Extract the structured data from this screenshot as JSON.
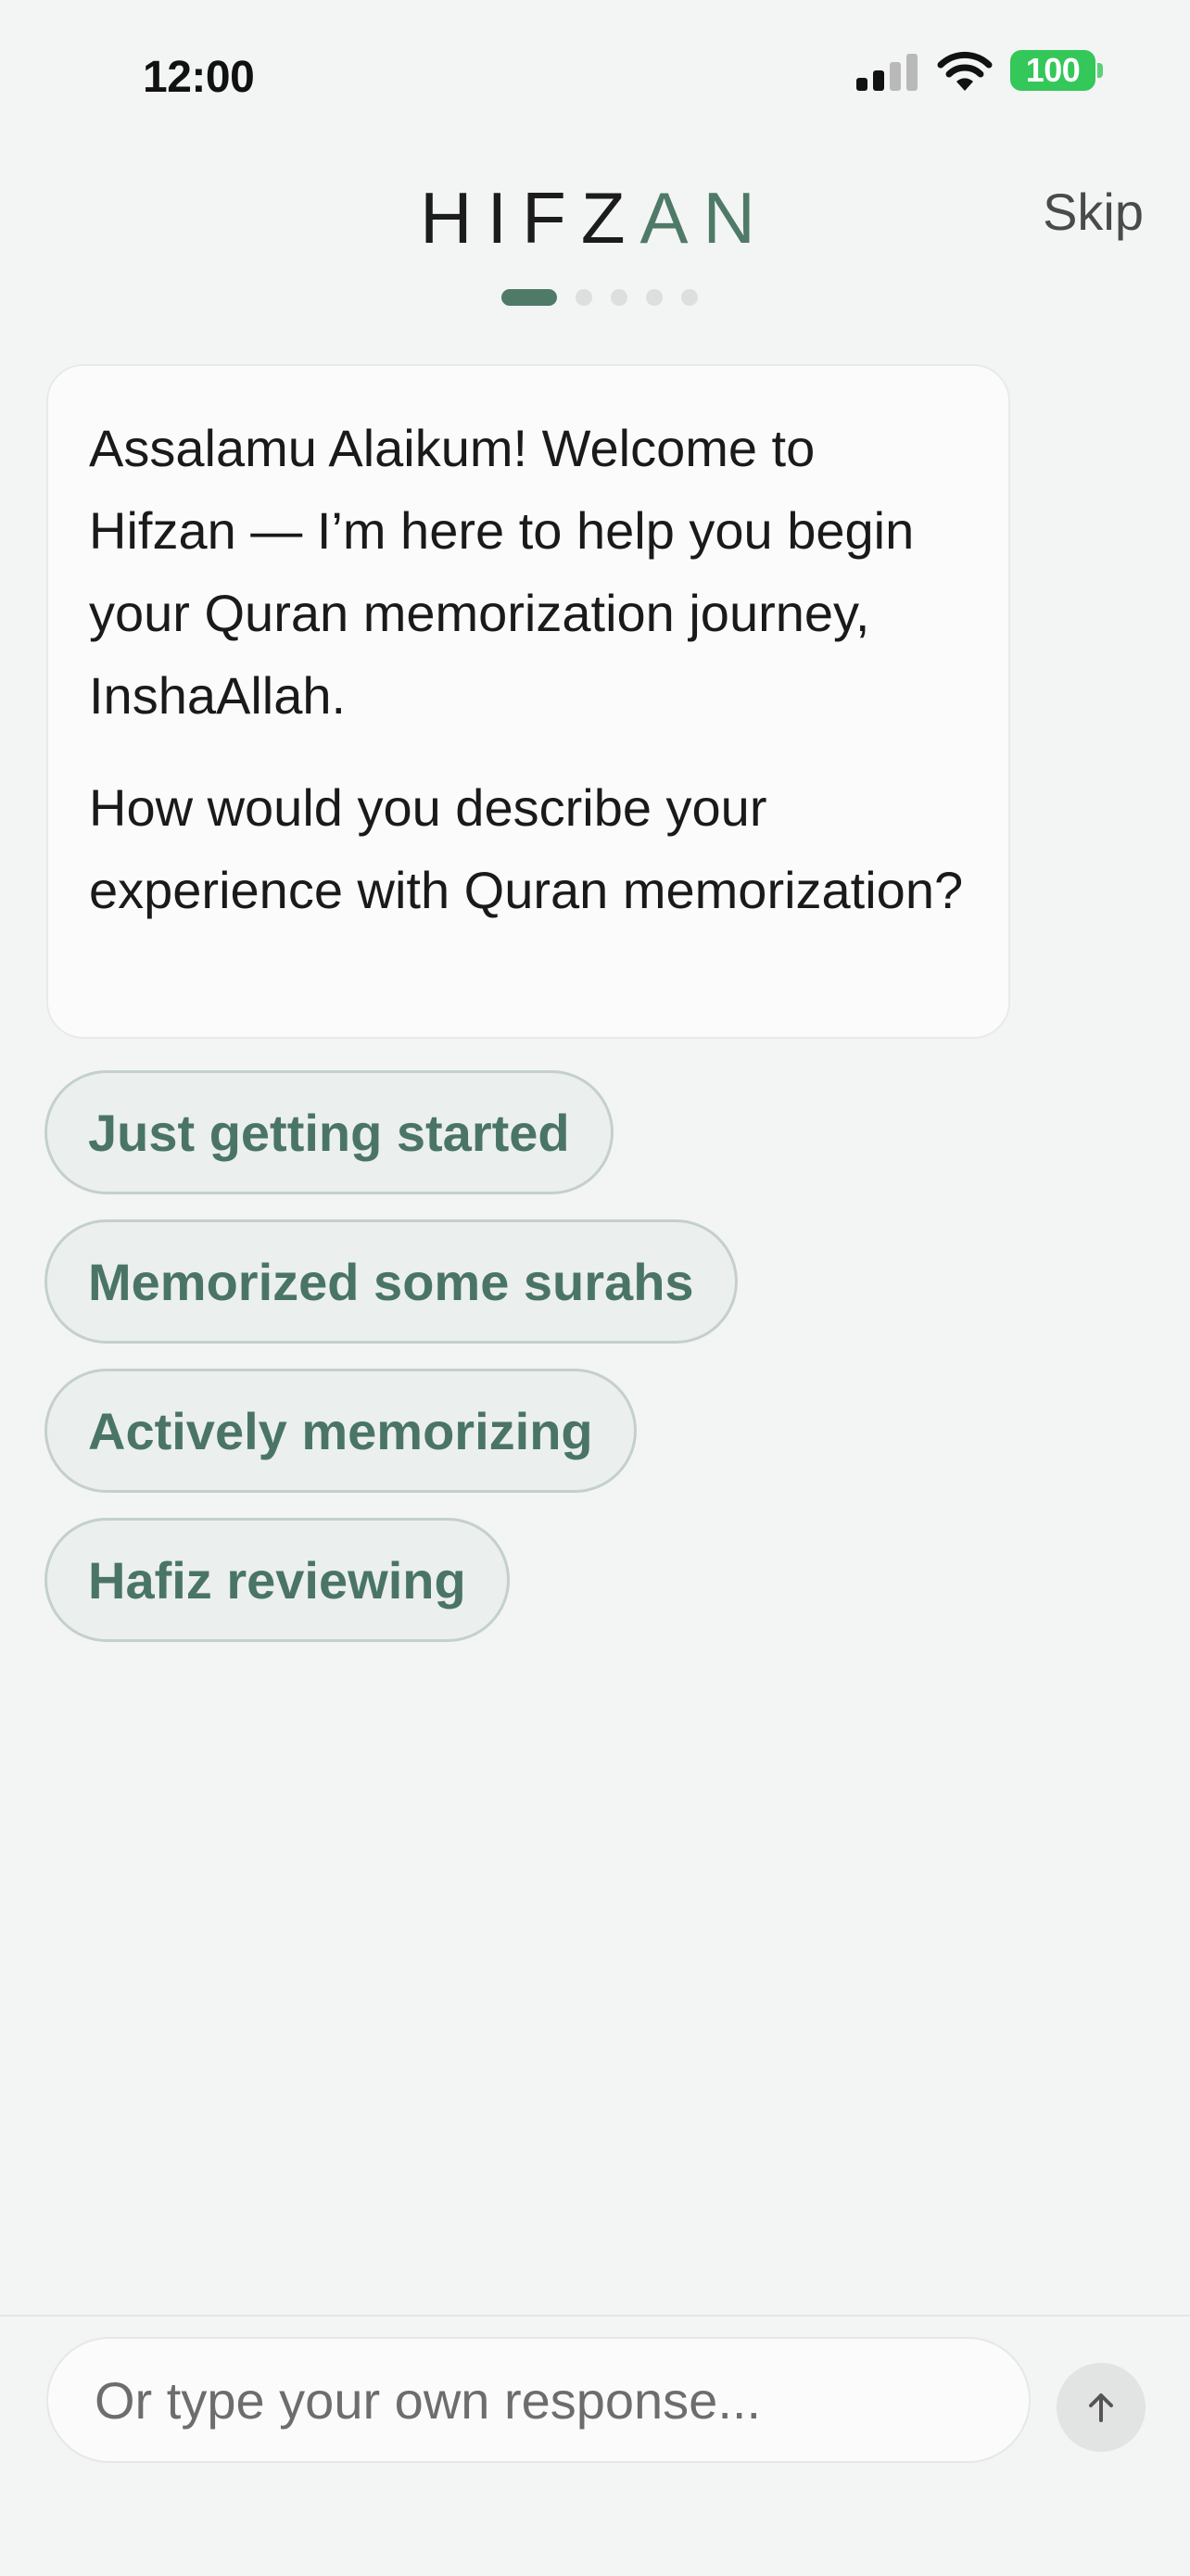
{
  "status_bar": {
    "time": "12:00",
    "battery_level": "100",
    "icons": [
      "signal-bars-icon",
      "wifi-icon",
      "battery-icon"
    ],
    "battery_color": "#34c759"
  },
  "header": {
    "logo_primary": "HIFZ",
    "logo_accent": "AN",
    "skip_label": "Skip",
    "progress": {
      "current_step": 1,
      "total_steps": 5
    }
  },
  "chat": {
    "assistant_message": {
      "paragraph_1": "Assalamu Alaikum! Welcome to Hifzan — I’m here to help you begin your Quran memorization journey, InshaAllah.",
      "paragraph_2": "How would you describe your experience with Quran memorization?"
    }
  },
  "options": [
    {
      "label": "Just getting started"
    },
    {
      "label": "Memorized some surahs"
    },
    {
      "label": "Actively memorizing"
    },
    {
      "label": "Hafiz reviewing"
    }
  ],
  "input": {
    "value": "",
    "placeholder": "Or type your own response..."
  },
  "send": {
    "icon": "arrow-up-icon"
  },
  "colors": {
    "accent": "#4f7a68",
    "background": "#f3f5f4",
    "chip_background": "#ebefed",
    "chip_text": "#4a7566"
  }
}
